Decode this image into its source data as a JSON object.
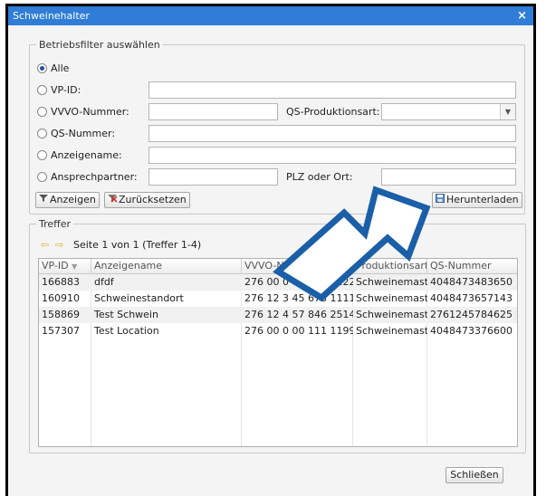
{
  "window": {
    "title": "Schweinehalter",
    "close_symbol": "×"
  },
  "filter": {
    "legend": "Betriebsfilter auswählen",
    "options": {
      "all": "Alle",
      "vp_id": "VP-ID:",
      "vvvo": "VVVO-Nummer:",
      "qs": "QS-Nummer:",
      "anzeigename": "Anzeigename:",
      "ansprechpartner": "Ansprechpartner:"
    },
    "selected": "all",
    "qs_produktionsart_label": "QS-Produktionsart:",
    "plz_label": "PLZ oder Ort:",
    "values": {
      "vp_id": "",
      "vvvo": "",
      "qs_produktionsart": "",
      "qs": "",
      "anzeigename": "",
      "ansprechpartner": "",
      "plz": ""
    }
  },
  "buttons": {
    "anzeigen": "Anzeigen",
    "zuruecksetzen": "Zurücksetzen",
    "herunterladen": "Herunterladen",
    "schliessen": "Schließen"
  },
  "results": {
    "legend": "Treffer",
    "pager_text": "Seite 1 von 1 (Treffer 1-4)",
    "columns": [
      "VP-ID",
      "Anzeigename",
      "VVVO-Nummer",
      "Produktionsart",
      "QS-Nummer"
    ],
    "rows": [
      [
        "166883",
        "dfdf",
        "276 00 0 00 111 2222",
        "Schweinemast",
        "4048473483650"
      ],
      [
        "160910",
        "Schweinestandort",
        "276 12 3 45 678 1111",
        "Schweinemast",
        "4048473657143"
      ],
      [
        "158869",
        "Test Schwein",
        "276 12 4 57 846 2514",
        "Schweinemast",
        "2761245784625"
      ],
      [
        "157307",
        "Test Location",
        "276 00 0 00 111 1199",
        "Schweinemast",
        "4048473376600"
      ]
    ]
  },
  "colors": {
    "titlebar": "#2f7dd6",
    "annotation_arrow": "#1a5fa8"
  }
}
